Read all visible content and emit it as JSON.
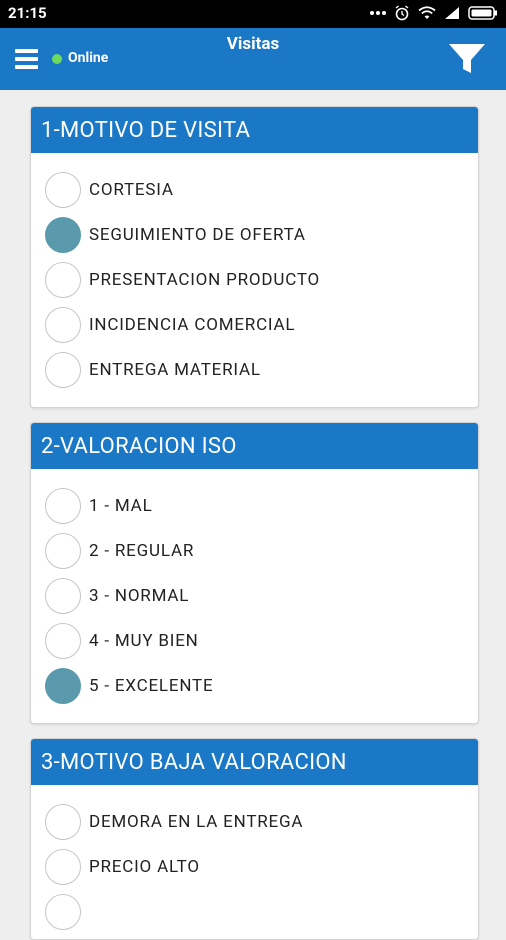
{
  "status_bar": {
    "time": "21:15",
    "icons": [
      "dots-icon",
      "alarm-icon",
      "wifi-icon",
      "signal-icon",
      "battery-icon"
    ]
  },
  "app_bar": {
    "title": "Visitas",
    "online_label": "Online",
    "menu_icon": "hamburger-menu-icon",
    "filter_icon": "filter-icon",
    "colors": {
      "bar": "#1b78c6",
      "online_dot": "#6ddb5d"
    }
  },
  "sections": [
    {
      "title": "1-MOTIVO DE VISITA",
      "options": [
        {
          "label": "CORTESIA",
          "selected": false
        },
        {
          "label": "SEGUIMIENTO DE OFERTA",
          "selected": true
        },
        {
          "label": "PRESENTACION PRODUCTO",
          "selected": false
        },
        {
          "label": "INCIDENCIA COMERCIAL",
          "selected": false
        },
        {
          "label": "ENTREGA MATERIAL",
          "selected": false
        }
      ]
    },
    {
      "title": "2-VALORACION ISO",
      "options": [
        {
          "label": "1 - MAL",
          "selected": false
        },
        {
          "label": "2 - REGULAR",
          "selected": false
        },
        {
          "label": "3 - NORMAL",
          "selected": false
        },
        {
          "label": "4 - MUY BIEN",
          "selected": false
        },
        {
          "label": "5 - EXCELENTE",
          "selected": true
        }
      ]
    },
    {
      "title": "3-MOTIVO BAJA VALORACION",
      "options": [
        {
          "label": "DEMORA EN LA ENTREGA",
          "selected": false
        },
        {
          "label": "PRECIO ALTO",
          "selected": false
        },
        {
          "label": "",
          "selected": false
        }
      ]
    }
  ],
  "colors": {
    "selected_radio": "#5a9aac",
    "card_header": "#1b78c6",
    "background": "#eeeeee"
  }
}
